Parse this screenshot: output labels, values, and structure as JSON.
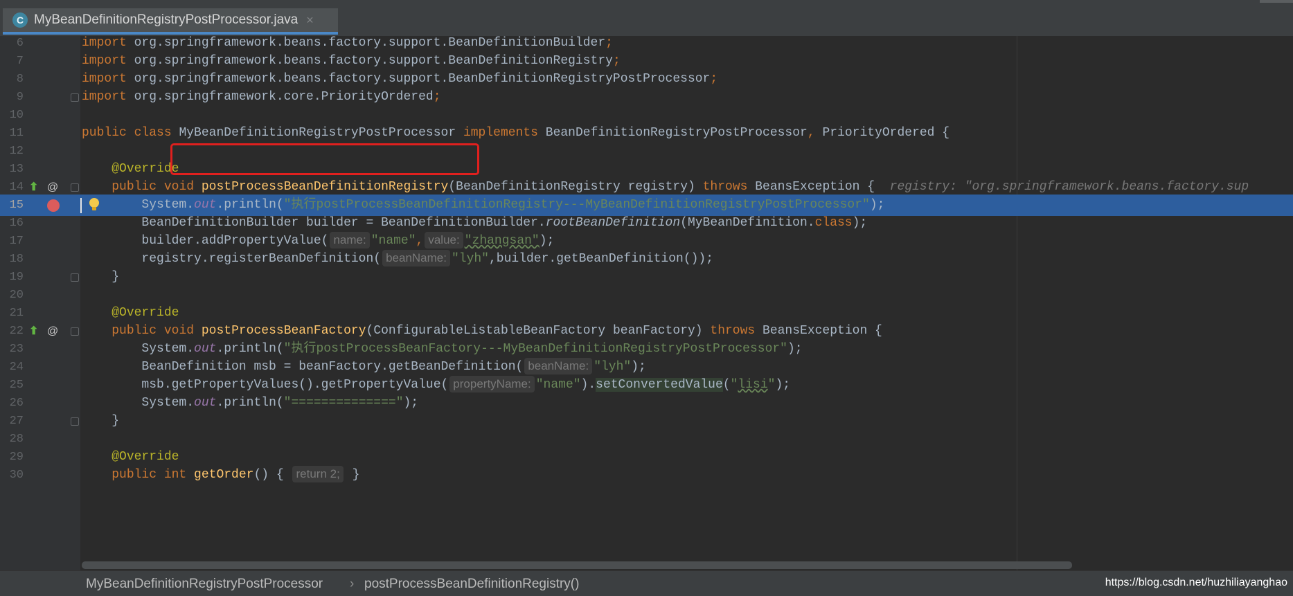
{
  "tab": {
    "icon": "C",
    "title": "MyBeanDefinitionRegistryPostProcessor.java",
    "close": "×"
  },
  "lines": [
    {
      "n": "6"
    },
    {
      "n": "7"
    },
    {
      "n": "8"
    },
    {
      "n": "9"
    },
    {
      "n": "10"
    },
    {
      "n": "11"
    },
    {
      "n": "12"
    },
    {
      "n": "13"
    },
    {
      "n": "14"
    },
    {
      "n": "15"
    },
    {
      "n": "16"
    },
    {
      "n": "17"
    },
    {
      "n": "18"
    },
    {
      "n": "19"
    },
    {
      "n": "20"
    },
    {
      "n": "21"
    },
    {
      "n": "22"
    },
    {
      "n": "23"
    },
    {
      "n": "24"
    },
    {
      "n": "25"
    },
    {
      "n": "26"
    },
    {
      "n": "27"
    },
    {
      "n": "28"
    },
    {
      "n": "29"
    },
    {
      "n": "30"
    }
  ],
  "tok": {
    "import": "import",
    "i6": " org.springframework.beans.factory.support.BeanDefinitionBuilder",
    "i7": " org.springframework.beans.factory.support.BeanDefinitionRegistry",
    "i8": " org.springframework.beans.factory.support.BeanDefinitionRegistryPostProcessor",
    "i9": " org.springframework.core.PriorityOrdered",
    "semi": ";",
    "public": "public",
    "class": "class",
    "className": "MyBeanDefinitionRegistryPostProcessor",
    "implements": "implements",
    "iface1": " BeanDefinitionRegistryPostProcessor",
    "comma": ",",
    "iface2": " PriorityOrdered {",
    "override": "@Override",
    "void": "void",
    "m1": "postProcessBeanDefinitionRegistry",
    "m1params": "(BeanDefinitionRegistry registry) ",
    "throws": "throws",
    "beansEx": " BeansException {",
    "inlay14": "registry: \"org.springframework.beans.factory.sup",
    "system": "System.",
    "out": "out",
    "println": ".println(",
    "s15": "\"执行postProcessBeanDefinitionRegistry---MyBeanDefinitionRegistryPostProcessor\"",
    "closeStmt": ");",
    "l16a": "BeanDefinitionBuilder builder = BeanDefinitionBuilder.",
    "l16b": "rootBeanDefinition",
    "l16c": "(MyBeanDefinition.",
    "l16d": ");",
    "l17a": "builder.addPropertyValue(",
    "hintName": "name:",
    "s17a": "\"name\"",
    "hintValue": "value:",
    "s17b": "\"zhangsan\"",
    "l18a": "registry.registerBeanDefinition(",
    "hintBeanName": "beanName:",
    "s18": "\"lyh\"",
    "l18b": ",builder.getBeanDefinition());",
    "brace": "}",
    "m2": "postProcessBeanFactory",
    "m2params": "(ConfigurableListableBeanFactory beanFactory) ",
    "s23": "\"执行postProcessBeanFactory---MyBeanDefinitionRegistryPostProcessor\"",
    "l24a": "BeanDefinition msb = beanFactory.getBeanDefinition(",
    "s24": "\"lyh\"",
    "l25a": "msb.getPropertyValues().getPropertyValue(",
    "hintPropertyName": "propertyName:",
    "s25a": "\"name\"",
    "l25b": ").",
    "setConverted": "setConvertedValue",
    "paren": "(",
    "quote": "\"",
    "s25b": "lisi",
    "s26": "\"==============\"",
    "l30a": "public int ",
    "l30b": "getOrder",
    "l30c": "() { ",
    "l30d": "return 2;",
    "l30e": " }"
  },
  "breadcrumb": {
    "item1": "MyBeanDefinitionRegistryPostProcessor",
    "sep": "›",
    "item2": "postProcessBeanDefinitionRegistry()"
  },
  "watermark": "https://blog.csdn.net/huzhiliayanghao",
  "colors": {
    "keyword": "#cc7832",
    "string": "#6a8759",
    "annotation": "#bbb529",
    "method": "#ffc66d",
    "highlight": "#2d5e9e",
    "redbox": "#e0201e"
  }
}
